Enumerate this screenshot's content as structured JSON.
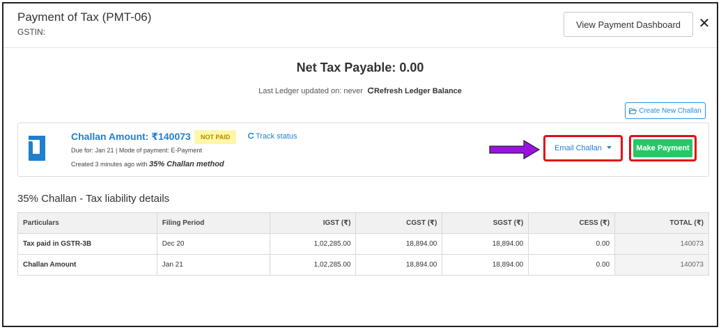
{
  "header": {
    "title": "Payment of Tax (PMT-06)",
    "gstin_label": "GSTIN:",
    "dashboard_button": "View Payment Dashboard",
    "close_symbol": "✕"
  },
  "summary": {
    "net_tax": "Net Tax Payable: 0.00",
    "ledger_text": "Last Ledger updated on: never",
    "refresh_label": "Refresh Ledger Balance",
    "create_new_challan": "Create New Challan"
  },
  "challan": {
    "amount_label": "Challan Amount: ₹140073",
    "status_badge": "NOT PAID",
    "track_status": "Track status",
    "due_info": "Due for: Jan 21 | Mode of payment: E-Payment",
    "created_prefix": "Created 3 minutes ago with",
    "method": "35% Challan method",
    "email_button": "Email Challan",
    "make_payment_button": "Make Payment"
  },
  "liability": {
    "section_title": "35% Challan - Tax liability details",
    "columns": [
      "Particulars",
      "Filing Period",
      "IGST (₹)",
      "CGST (₹)",
      "SGST (₹)",
      "CESS (₹)",
      "TOTAL (₹)"
    ],
    "rows": [
      [
        "Tax paid in GSTR-3B",
        "Dec 20",
        "1,02,285.00",
        "18,894.00",
        "18,894.00",
        "0.00",
        "140073"
      ],
      [
        "Challan Amount",
        "Jan 21",
        "1,02,285.00",
        "18,894.00",
        "18,894.00",
        "0.00",
        "140073"
      ]
    ]
  },
  "colors": {
    "primary_blue": "#1f7fd0",
    "pay_green": "#27c768",
    "highlight_red": "#e30b17",
    "arrow_purple": "#9b12e0",
    "badge_yellow": "#fff7a8"
  },
  "icons": {
    "challan": "challan-document-icon",
    "refresh": "refresh-icon",
    "track": "refresh-icon",
    "folder": "folder-open-icon",
    "caret": "caret-down-icon",
    "arrow": "right-arrow-icon"
  }
}
